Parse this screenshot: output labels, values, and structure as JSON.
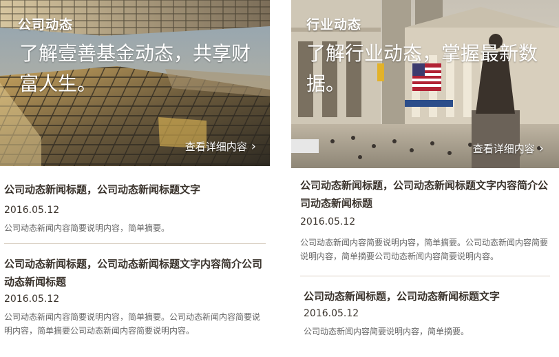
{
  "left": {
    "hero": {
      "tag": "公司动态",
      "slogan": "了解壹善基金动态，共享财富人生。",
      "more": "查看详细内容",
      "chevron_icon": "chevron-right-icon"
    },
    "news": [
      {
        "title": "公司动态新闻标题，公司动态新闻标题文字",
        "date": "2016.05.12",
        "summary": "公司动态新闻内容简要说明内容，简单摘要。"
      },
      {
        "title": "公司动态新闻标题，公司动态新闻标题文字内容简介公司动态新闻标题",
        "date": "2016.05.12",
        "summary": "公司动态新闻内容简要说明内容，简单摘要。公司动态新闻内容简要说明内容，简单摘要公司动态新闻内容简要说明内容。"
      }
    ]
  },
  "right": {
    "hero": {
      "tag": "行业动态",
      "slogan": "了解行业动态，掌握最新数据。",
      "more": "查看详细内容",
      "chevron_icon": "chevron-right-icon"
    },
    "news": [
      {
        "title": "公司动态新闻标题，公司动态新闻标题文字内容简介公司动态新闻标题",
        "date": "2016.05.12",
        "summary": "公司动态新闻内容简要说明内容，简单摘要。公司动态新闻内容简要说明内容，简单摘要公司动态新闻内容简要说明内容。"
      },
      {
        "title": "公司动态新闻标题，公司动态新闻标题文字",
        "date": "2016.05.12",
        "summary": "公司动态新闻内容简要说明内容，简单摘要。"
      }
    ]
  }
}
